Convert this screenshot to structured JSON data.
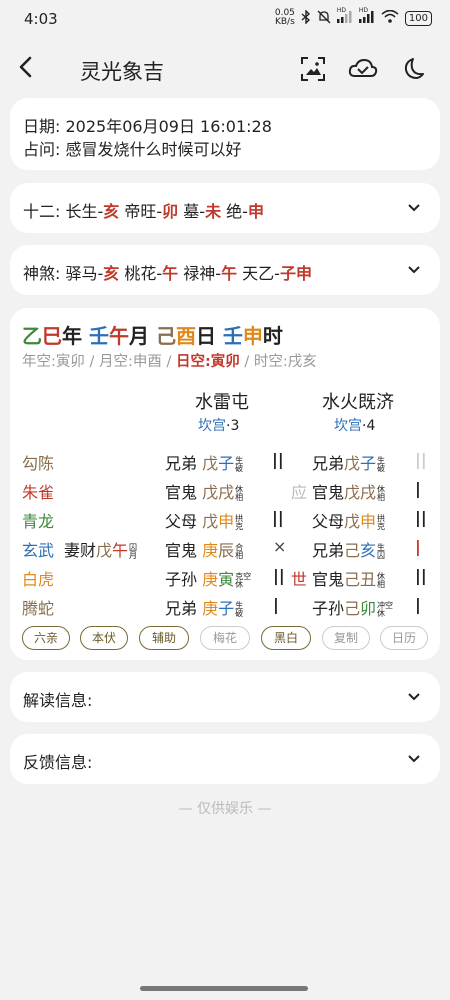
{
  "status": {
    "time": "4:03",
    "net_rate": "0.05",
    "net_unit": "KB/s",
    "battery": "100",
    "hd1": "HD",
    "hd2": "HD"
  },
  "appbar": {
    "title": "灵光象吉"
  },
  "info": {
    "date_label": "日期:",
    "date_value": "2025年06月09日 16:01:28",
    "question_label": "占问:",
    "question_value": "感冒发烧什么时候可以好"
  },
  "twelve": {
    "label": "十二:",
    "items": [
      {
        "name": "长生-",
        "branch": "亥"
      },
      {
        "name": "帝旺-",
        "branch": "卯"
      },
      {
        "name": "墓-",
        "branch": "未"
      },
      {
        "name": "绝-",
        "branch": "申"
      }
    ]
  },
  "shensha": {
    "label": "神煞:",
    "items": [
      {
        "name": "驿马-",
        "branch": "亥"
      },
      {
        "name": "桃花-",
        "branch": "午"
      },
      {
        "name": "禄神-",
        "branch": "午"
      },
      {
        "name": "天乙-",
        "branch": "子申"
      }
    ]
  },
  "pillars": {
    "year": {
      "stem": "乙",
      "branch": "巳",
      "suffix": "年"
    },
    "month": {
      "stem": "壬",
      "branch": "午",
      "suffix": "月"
    },
    "day": {
      "stem": "己",
      "branch": "酉",
      "suffix": "日"
    },
    "hour": {
      "stem": "壬",
      "branch": "申",
      "suffix": "时"
    },
    "kong": {
      "year": "年空:寅卯",
      "sep": "/",
      "month": "月空:申酉",
      "day": "日空:寅卯",
      "hour": "时空:戌亥"
    }
  },
  "gua": {
    "main": {
      "name": "水雷屯",
      "palace": "坎宫",
      "num": "·3"
    },
    "changed": {
      "name": "水火既济",
      "palace": "坎宫",
      "num": "·4"
    }
  },
  "lines": [
    {
      "god": "勾陈",
      "fu": "",
      "left_rel": "兄弟",
      "left_stem": "戊",
      "left_branch": "子",
      "left_s1": "生",
      "left_s2": "破",
      "mark": "",
      "left_yao": "||",
      "mid": "",
      "right_rel": "兄弟",
      "right_stem": "戊",
      "right_branch": "子",
      "right_s1": "生",
      "right_s2": "破",
      "right_yao": "||"
    },
    {
      "god": "朱雀",
      "fu": "",
      "left_rel": "官鬼",
      "left_stem": "戊",
      "left_branch": "戌",
      "left_s1": "休",
      "left_s2": "相",
      "mark": "",
      "left_yao": "",
      "mid": "应",
      "right_rel": "官鬼",
      "right_stem": "戊",
      "right_branch": "戌",
      "right_s1": "休",
      "right_s2": "相",
      "right_yao": "|"
    },
    {
      "god": "青龙",
      "fu": "",
      "left_rel": "父母",
      "left_stem": "戊",
      "left_branch": "申",
      "left_s1": "拱",
      "left_s2": "克",
      "mark": "",
      "left_yao": "||",
      "mid": "",
      "right_rel": "父母",
      "right_stem": "戊",
      "right_branch": "申",
      "right_s1": "拱",
      "right_s2": "克",
      "right_yao": "||"
    },
    {
      "god": "玄武",
      "fu": "妻财",
      "fu_stem": "戊",
      "fu_branch": "午",
      "fu_s1": "囚",
      "fu_s2": "月",
      "left_rel": "官鬼",
      "left_stem": "庚",
      "left_branch": "辰",
      "left_s1": "合",
      "left_s2": "相",
      "mark": "×",
      "left_yao": "",
      "mid": "",
      "right_rel": "兄弟",
      "right_stem": "己",
      "right_branch": "亥",
      "right_s1": "生",
      "right_s2": "囚",
      "right_yao": "|"
    },
    {
      "god": "白虎",
      "fu": "",
      "left_rel": "子孙",
      "left_stem": "庚",
      "left_branch": "寅",
      "left_s1": "克空",
      "left_s2": "休",
      "mark": "||",
      "left_yao": "",
      "mid": "世",
      "right_rel": "官鬼",
      "right_stem": "己",
      "right_branch": "丑",
      "right_s1": "休",
      "right_s2": "相",
      "right_yao": "||"
    },
    {
      "god": "腾蛇",
      "fu": "",
      "left_rel": "兄弟",
      "left_stem": "庚",
      "left_branch": "子",
      "left_s1": "生",
      "left_s2": "破",
      "mark": "|",
      "left_yao": "",
      "mid": "",
      "right_rel": "子孙",
      "right_stem": "己",
      "right_branch": "卯",
      "right_s1": "冲空",
      "right_s2": "休",
      "right_yao": "|"
    }
  ],
  "chips": [
    {
      "label": "六亲",
      "on": true
    },
    {
      "label": "本伏",
      "on": true
    },
    {
      "label": "辅助",
      "on": true
    },
    {
      "label": "梅花",
      "on": false
    },
    {
      "label": "黑白",
      "on": true
    },
    {
      "label": "复制",
      "on": false
    },
    {
      "label": "日历",
      "on": false
    }
  ],
  "sections": {
    "interpret": "解读信息:",
    "feedback": "反馈信息:"
  },
  "footer": "— 仅供娱乐 —",
  "colors": {
    "red": "#c0392b",
    "orange": "#e08a1e",
    "blue": "#2c6fb7",
    "green": "#3c8a3c",
    "brown": "#8a6d4d"
  }
}
